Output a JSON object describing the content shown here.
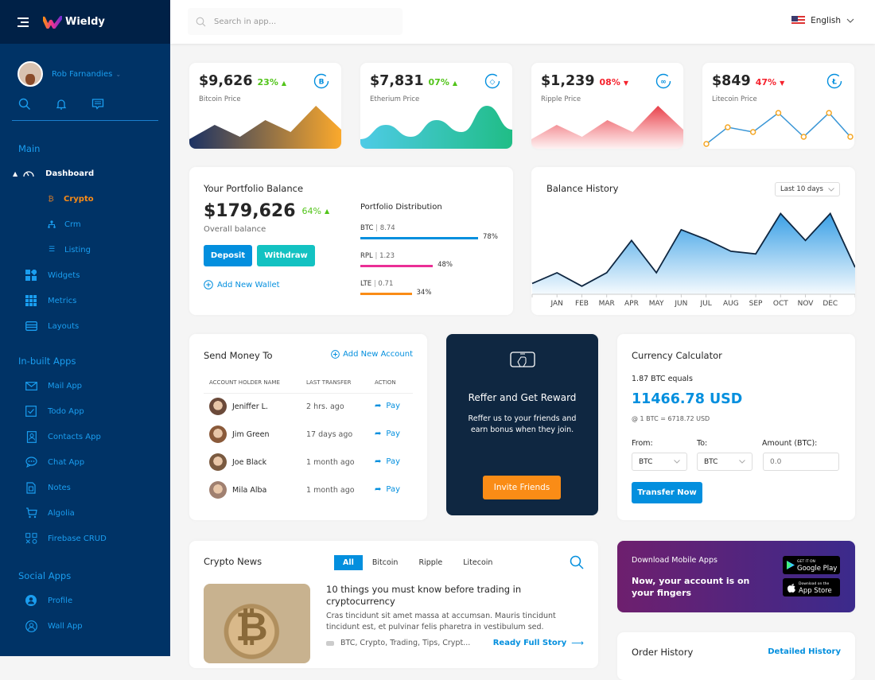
{
  "sidebar": {
    "logo": "Wieldy",
    "user_name": "Rob Farnandies",
    "sections": [
      {
        "title": "Main"
      },
      {
        "title": "In-built Apps"
      },
      {
        "title": "Social Apps"
      }
    ],
    "main_items": [
      {
        "label": "Dashboard",
        "icon": "dashboard-gauge-icon"
      },
      {
        "label": "Crypto",
        "icon": "bitcoin-icon"
      },
      {
        "label": "Crm",
        "icon": "org-chart-icon"
      },
      {
        "label": "Listing",
        "icon": "list-icon"
      },
      {
        "label": "Widgets",
        "icon": "widgets-icon"
      },
      {
        "label": "Metrics",
        "icon": "grid-icon"
      },
      {
        "label": "Layouts",
        "icon": "layout-icon"
      }
    ],
    "app_items": [
      {
        "label": "Mail App",
        "icon": "mail-icon"
      },
      {
        "label": "Todo App",
        "icon": "checkbox-icon"
      },
      {
        "label": "Contacts App",
        "icon": "contacts-icon"
      },
      {
        "label": "Chat App",
        "icon": "chat-icon"
      },
      {
        "label": "Notes",
        "icon": "notes-icon"
      },
      {
        "label": "Algolia",
        "icon": "cart-icon"
      },
      {
        "label": "Firebase CRUD",
        "icon": "crud-icon"
      }
    ],
    "social_items": [
      {
        "label": "Profile",
        "icon": "profile-icon"
      },
      {
        "label": "Wall App",
        "icon": "user-circle-icon"
      }
    ],
    "colors": {
      "bg": "#003366",
      "active": "#fa8c16",
      "accent": "#1a9ef0"
    }
  },
  "topbar": {
    "search_placeholder": "Search in app...",
    "language": "English"
  },
  "price_cards": [
    {
      "price": "$9,626",
      "change": "23%",
      "direction": "up",
      "label": "Bitcoin Price",
      "icon": "bitcoin-circle-icon",
      "spark": [
        2,
        5,
        2.5,
        6,
        3.5,
        9,
        4
      ]
    },
    {
      "price": "$7,831",
      "change": "07%",
      "direction": "up",
      "label": "Etherium Price",
      "icon": "ethereum-circle-icon",
      "spark": [
        2,
        5,
        2.5,
        6,
        3.5,
        9,
        4
      ]
    },
    {
      "price": "$1,239",
      "change": "08%",
      "direction": "down",
      "label": "Ripple Price",
      "icon": "ripple-circle-icon",
      "spark": [
        2,
        5,
        2.5,
        6,
        3.5,
        9,
        4
      ]
    },
    {
      "price": "$849",
      "change": "47%",
      "direction": "down",
      "label": "Litecoin Price",
      "icon": "litecoin-circle-icon",
      "spark": [
        1,
        4.5,
        3.5,
        7.5,
        2.5,
        7.5,
        2.5
      ]
    }
  ],
  "portfolio": {
    "title": "Your Portfolio Balance",
    "balance": "$179,626",
    "change": "64%",
    "sub": "Overall balance",
    "deposit": "Deposit",
    "withdraw": "Withdraw",
    "add_wallet": "Add New Wallet",
    "dist_title": "Portfolio Distribution",
    "distribution": [
      {
        "coin": "BTC",
        "amount": "8.74",
        "pct": "78%",
        "value": 78,
        "color": "#038fde"
      },
      {
        "coin": "RPL",
        "amount": "1.23",
        "pct": "48%",
        "value": 48,
        "color": "#eb2f96"
      },
      {
        "coin": "LTE",
        "amount": "0.71",
        "pct": "34%",
        "value": 34,
        "color": "#fa8c16"
      }
    ]
  },
  "balance_history": {
    "title": "Balance History",
    "range": "Last 10 days"
  },
  "chart_data": {
    "type": "area",
    "title": "Balance History",
    "categories": [
      "",
      "JAN",
      "FEB",
      "MAR",
      "APR",
      "MAY",
      "JUN",
      "JUL",
      "AUG",
      "SEP",
      "OCT",
      "NOV",
      "DEC",
      ""
    ],
    "values": [
      2,
      4,
      1.5,
      4,
      10,
      4,
      12,
      10.2,
      8,
      7.5,
      15,
      10,
      15,
      5
    ],
    "ylim": [
      0,
      17
    ],
    "xlabel": "",
    "ylabel": "",
    "grid": false
  },
  "send_money": {
    "title": "Send Money To",
    "add_account": "Add New Account",
    "headers": [
      "ACCOUNT HOLDER NAME",
      "LAST TRANSFER",
      "ACTION"
    ],
    "rows": [
      {
        "name": "Jeniffer L.",
        "last": "2 hrs. ago",
        "action": "Pay"
      },
      {
        "name": "Jim Green",
        "last": "17 days ago",
        "action": "Pay"
      },
      {
        "name": "Joe Black",
        "last": "1 month ago",
        "action": "Pay"
      },
      {
        "name": "Mila Alba",
        "last": "1 month ago",
        "action": "Pay"
      }
    ]
  },
  "referral": {
    "title": "Reffer and Get Reward",
    "text": "Reffer us to your friends and earn bonus when they join.",
    "button": "Invite Friends"
  },
  "calculator": {
    "title": "Currency Calculator",
    "equals": "1.87 BTC equals",
    "result": "11466.78 USD",
    "rate": "@ 1 BTC = 6718.72 USD",
    "from_label": "From:",
    "to_label": "To:",
    "amount_label": "Amount (BTC):",
    "from_value": "BTC",
    "to_value": "BTC",
    "amount_placeholder": "0.0",
    "button": "Transfer Now"
  },
  "news": {
    "title": "Crypto News",
    "tabs": [
      "All",
      "Bitcoin",
      "Ripple",
      "Litecoin"
    ],
    "active_tab": "All",
    "headline": "10 things you must know before trading in cryptocurrency",
    "body": "Cras tincidunt sit amet massa at accumsan. Mauris tincidunt tincidunt est, et pulvinar felis pharetra in vestibulum sed.",
    "tags": "BTC, Crypto, Trading, Tips, Crypt...",
    "read_more": "Ready Full Story"
  },
  "download": {
    "title": "Download Mobile Apps",
    "subtitle": "Now, your account is on your fingers",
    "google_small": "GET IT ON",
    "google": "Google Play",
    "apple_small": "Download on the",
    "apple": "App Store"
  },
  "orders": {
    "title": "Order History",
    "link": "Detailed History"
  }
}
